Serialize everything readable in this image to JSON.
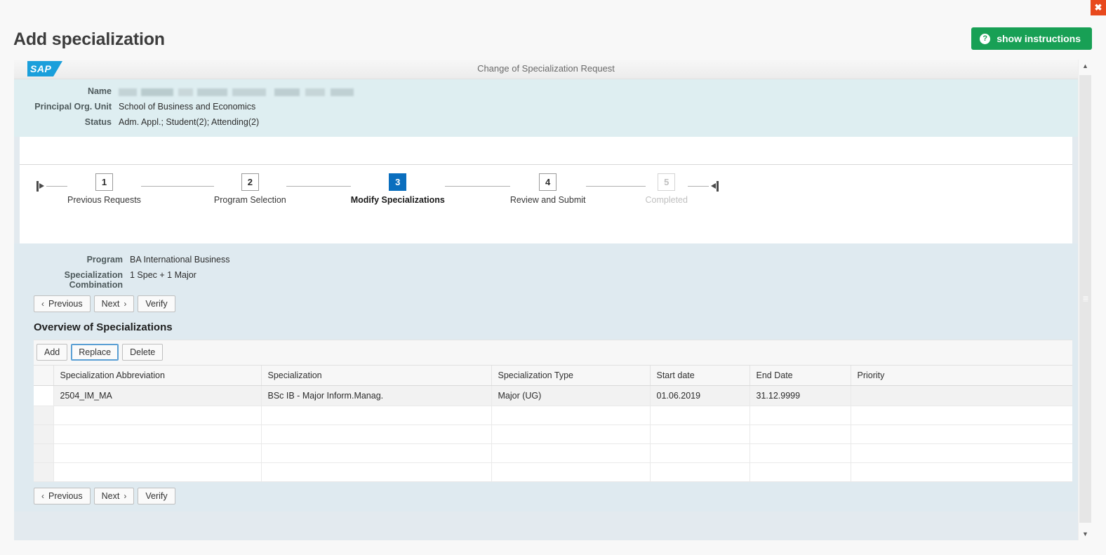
{
  "window": {
    "close_label": "✖"
  },
  "header": {
    "title": "Add specialization",
    "instructions_button": "show instructions",
    "help_icon_glyph": "?"
  },
  "sap": {
    "logo_text": "SAP",
    "frame_title": "Change of Specialization Request",
    "info_fields": [
      {
        "label": "Name",
        "value": "",
        "redacted": true
      },
      {
        "label": "Principal Org. Unit",
        "value": "School of Business and Economics",
        "redacted": false
      },
      {
        "label": "Status",
        "value": "Adm. Appl.; Student(2); Attending(2)",
        "redacted": false
      }
    ],
    "stepper": {
      "steps": [
        {
          "number": "1",
          "label": "Previous Requests",
          "state": "done"
        },
        {
          "number": "2",
          "label": "Program Selection",
          "state": "done"
        },
        {
          "number": "3",
          "label": "Modify Specializations",
          "state": "active"
        },
        {
          "number": "4",
          "label": "Review and Submit",
          "state": "upcoming"
        },
        {
          "number": "5",
          "label": "Completed",
          "state": "disabled"
        }
      ]
    },
    "program_fields": [
      {
        "label": "Program",
        "value": "BA International Business"
      },
      {
        "label": "Specialization Combination",
        "value": "1 Spec + 1 Major"
      }
    ],
    "nav_buttons": {
      "previous": "Previous",
      "next": "Next",
      "verify": "Verify",
      "prev_chevron": "‹",
      "next_chevron": "›"
    },
    "overview": {
      "title": "Overview of Specializations",
      "toolbar": {
        "add": "Add",
        "replace": "Replace",
        "delete": "Delete",
        "focused": "replace"
      },
      "table": {
        "columns": [
          "Specialization Abbreviation",
          "Specialization",
          "Specialization Type",
          "Start date",
          "End Date",
          "Priority"
        ],
        "rows": [
          {
            "abbreviation": "2504_IM_MA",
            "specialization": "BSc IB - Major Inform.Manag.",
            "type": "Major (UG)",
            "start_date": "01.06.2019",
            "end_date": "31.12.9999",
            "priority": ""
          },
          {
            "abbreviation": "",
            "specialization": "",
            "type": "",
            "start_date": "",
            "end_date": "",
            "priority": ""
          },
          {
            "abbreviation": "",
            "specialization": "",
            "type": "",
            "start_date": "",
            "end_date": "",
            "priority": ""
          },
          {
            "abbreviation": "",
            "specialization": "",
            "type": "",
            "start_date": "",
            "end_date": "",
            "priority": ""
          },
          {
            "abbreviation": "",
            "specialization": "",
            "type": "",
            "start_date": "",
            "end_date": "",
            "priority": ""
          }
        ]
      }
    },
    "scrollbar": {
      "up_glyph": "▲",
      "down_glyph": "▼"
    }
  },
  "colors": {
    "accent_blue": "#0a6ebe",
    "brand_green": "#18a055",
    "close_orange": "#e8491d",
    "sap_logo_blue": "#1b9fdb",
    "panel_cyan": "#deeef1",
    "panel_bluegray": "#dfeaf0"
  }
}
